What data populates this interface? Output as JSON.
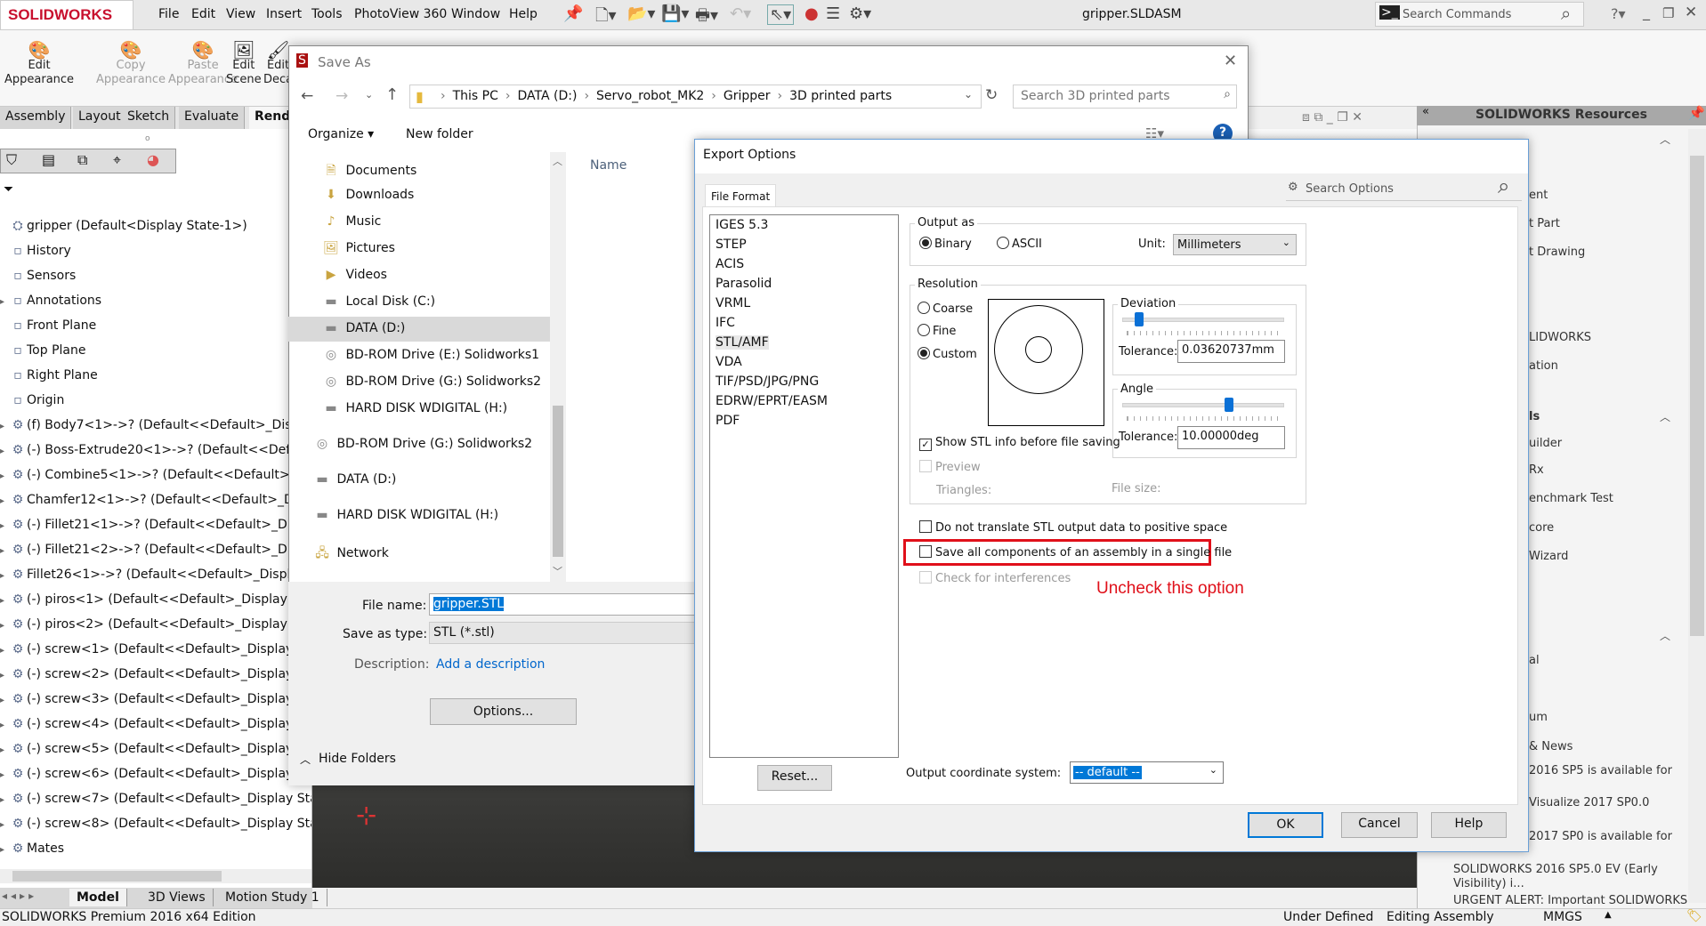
{
  "app": {
    "logo": "SOLIDWORKS",
    "title": "gripper.SLDASM",
    "menu": [
      "File",
      "Edit",
      "View",
      "Insert",
      "Tools",
      "PhotoView 360",
      "Window",
      "Help"
    ],
    "search_commands": "Search Commands",
    "brand_color": "#c8102e"
  },
  "ribbon": {
    "buttons": [
      {
        "l1": "Edit",
        "l2": "Appearance",
        "enabled": true
      },
      {
        "l1": "Copy",
        "l2": "Appearance",
        "enabled": false
      },
      {
        "l1": "Paste",
        "l2": "Appearance",
        "enabled": false
      },
      {
        "l1": "Edit",
        "l2": "Scene",
        "enabled": true
      },
      {
        "l1": "Edit",
        "l2": "Deca",
        "enabled": true
      }
    ],
    "tabs": [
      "Assembly",
      "Layout",
      "Sketch",
      "Evaluate",
      "Rend"
    ]
  },
  "tree": {
    "items": [
      {
        "label": "gripper  (Default<Display State-1>)",
        "exp": false
      },
      {
        "label": "History",
        "exp": false
      },
      {
        "label": "Sensors",
        "exp": false
      },
      {
        "label": "Annotations",
        "exp": true
      },
      {
        "label": "Front Plane",
        "exp": false
      },
      {
        "label": "Top Plane",
        "exp": false
      },
      {
        "label": "Right Plane",
        "exp": false
      },
      {
        "label": "Origin",
        "exp": false
      },
      {
        "label": "(f) Body7<1>->? (Default<<Default>_Disp",
        "exp": true
      },
      {
        "label": "(-) Boss-Extrude20<1>->? (Default<<Defa",
        "exp": true
      },
      {
        "label": "(-) Combine5<1>->? (Default<<Default>_",
        "exp": true
      },
      {
        "label": "Chamfer12<1>->? (Default<<Default>_D",
        "exp": true
      },
      {
        "label": "(-) Fillet21<1>->? (Default<<Default>_Di",
        "exp": true
      },
      {
        "label": "(-) Fillet21<2>->? (Default<<Default>_Di",
        "exp": true
      },
      {
        "label": "Fillet26<1>->? (Default<<Default>_Displa",
        "exp": true
      },
      {
        "label": "(-) piros<1> (Default<<Default>_Display S",
        "exp": true
      },
      {
        "label": "(-) piros<2> (Default<<Default>_Display S",
        "exp": true
      },
      {
        "label": "(-) screw<1> (Default<<Default>_Display",
        "exp": true
      },
      {
        "label": "(-) screw<2> (Default<<Default>_Display",
        "exp": true
      },
      {
        "label": "(-) screw<3> (Default<<Default>_Display",
        "exp": true
      },
      {
        "label": "(-) screw<4> (Default<<Default>_Display",
        "exp": true
      },
      {
        "label": "(-) screw<5> (Default<<Default>_Display",
        "exp": true
      },
      {
        "label": "(-) screw<6> (Default<<Default>_Display",
        "exp": true
      },
      {
        "label": "(-) screw<7> (Default<<Default>_Display Sta",
        "exp": true
      },
      {
        "label": "(-) screw<8> (Default<<Default>_Display Sta",
        "exp": true
      },
      {
        "label": "Mates",
        "exp": true
      }
    ]
  },
  "bottom_tabs": [
    "Model",
    "3D Views",
    "Motion Study 1"
  ],
  "status": {
    "edition": "SOLIDWORKS Premium 2016 x64 Edition",
    "state": "Under Defined",
    "mode": "Editing Assembly",
    "units": "MMGS"
  },
  "resources": {
    "title": "SOLIDWORKS Resources",
    "items": [
      "ent",
      "t Part",
      "t Drawing",
      "LIDWORKS",
      "ation",
      "ls",
      "uilder",
      "Rx",
      "enchmark Test",
      "core",
      "Wizard",
      "al",
      "um",
      "& News",
      "2016 SP5 is available for",
      "Visualize 2017 SP0.0",
      "2017 SP0 is available for",
      "SOLIDWORKS 2016 SP5.0 EV (Early",
      "Visibility) i...",
      "URGENT ALERT: Important SOLIDWORKS"
    ]
  },
  "saveas": {
    "title": "Save As",
    "breadcrumb": [
      "This PC",
      "DATA (D:)",
      "Servo_robot_MK2",
      "Gripper",
      "3D printed parts"
    ],
    "search_placeholder": "Search 3D printed parts",
    "organize": "Organize ▾",
    "new_folder": "New folder",
    "name_header": "Name",
    "nav": [
      {
        "label": "Documents",
        "icon": "documents-icon"
      },
      {
        "label": "Downloads",
        "icon": "downloads-icon"
      },
      {
        "label": "Music",
        "icon": "music-icon"
      },
      {
        "label": "Pictures",
        "icon": "pictures-icon"
      },
      {
        "label": "Videos",
        "icon": "videos-icon"
      },
      {
        "label": "Local Disk (C:)",
        "icon": "disk-icon"
      },
      {
        "label": "DATA (D:)",
        "icon": "disk-icon",
        "selected": true
      },
      {
        "label": "BD-ROM Drive (E:) Solidworks1",
        "icon": "disc-icon"
      },
      {
        "label": "BD-ROM Drive (G:) Solidworks2",
        "icon": "disc-icon"
      },
      {
        "label": "HARD DISK  WDIGITAL (H:)",
        "icon": "disk-icon"
      },
      {
        "label": "BD-ROM Drive (G:) Solidworks2",
        "icon": "disc-icon"
      },
      {
        "label": "DATA (D:)",
        "icon": "disk-icon"
      },
      {
        "label": "HARD DISK  WDIGITAL (H:)",
        "icon": "disk-icon"
      },
      {
        "label": "Network",
        "icon": "network-icon"
      }
    ],
    "file_name_label": "File name:",
    "file_name": "gripper.STL",
    "type_label": "Save as type:",
    "type": "STL (*.stl)",
    "desc_label": "Description:",
    "desc_link": "Add a description",
    "options": "Options...",
    "hide_folders": "Hide Folders"
  },
  "export": {
    "title": "Export Options",
    "tab": "File Format",
    "search_placeholder": "Search Options",
    "formats": [
      "IGES 5.3",
      "STEP",
      "ACIS",
      "Parasolid",
      "VRML",
      "IFC",
      "STL/AMF",
      "VDA",
      "TIF/PSD/JPG/PNG",
      "EDRW/EPRT/EASM",
      "PDF"
    ],
    "selected_format": "STL/AMF",
    "output_as": "Output as",
    "binary": "Binary",
    "ascii": "ASCII",
    "output_selected": "Binary",
    "unit_label": "Unit:",
    "unit": "Millimeters",
    "resolution": "Resolution",
    "coarse": "Coarse",
    "fine": "Fine",
    "custom": "Custom",
    "resolution_selected": "Custom",
    "deviation": "Deviation",
    "deviation_level": 0.08,
    "tol_label": "Tolerance:",
    "deviation_tol": "0.03620737mm",
    "angle": "Angle",
    "angle_level": 0.67,
    "angle_tol": "10.00000deg",
    "show_info": "Show STL info before file saving",
    "show_info_checked": true,
    "preview": "Preview",
    "triangles": "Triangles:",
    "file_size": "File size:",
    "no_translate": "Do not translate STL output data to positive space",
    "single_file": "Save all components of an assembly in a single file",
    "interferences": "Check for interferences",
    "annotation": "Uncheck this option",
    "annotation_color": "#e0101a",
    "reset": "Reset...",
    "coord_label": "Output coordinate system:",
    "coord": "-- default --",
    "ok": "OK",
    "cancel": "Cancel",
    "help": "Help"
  }
}
